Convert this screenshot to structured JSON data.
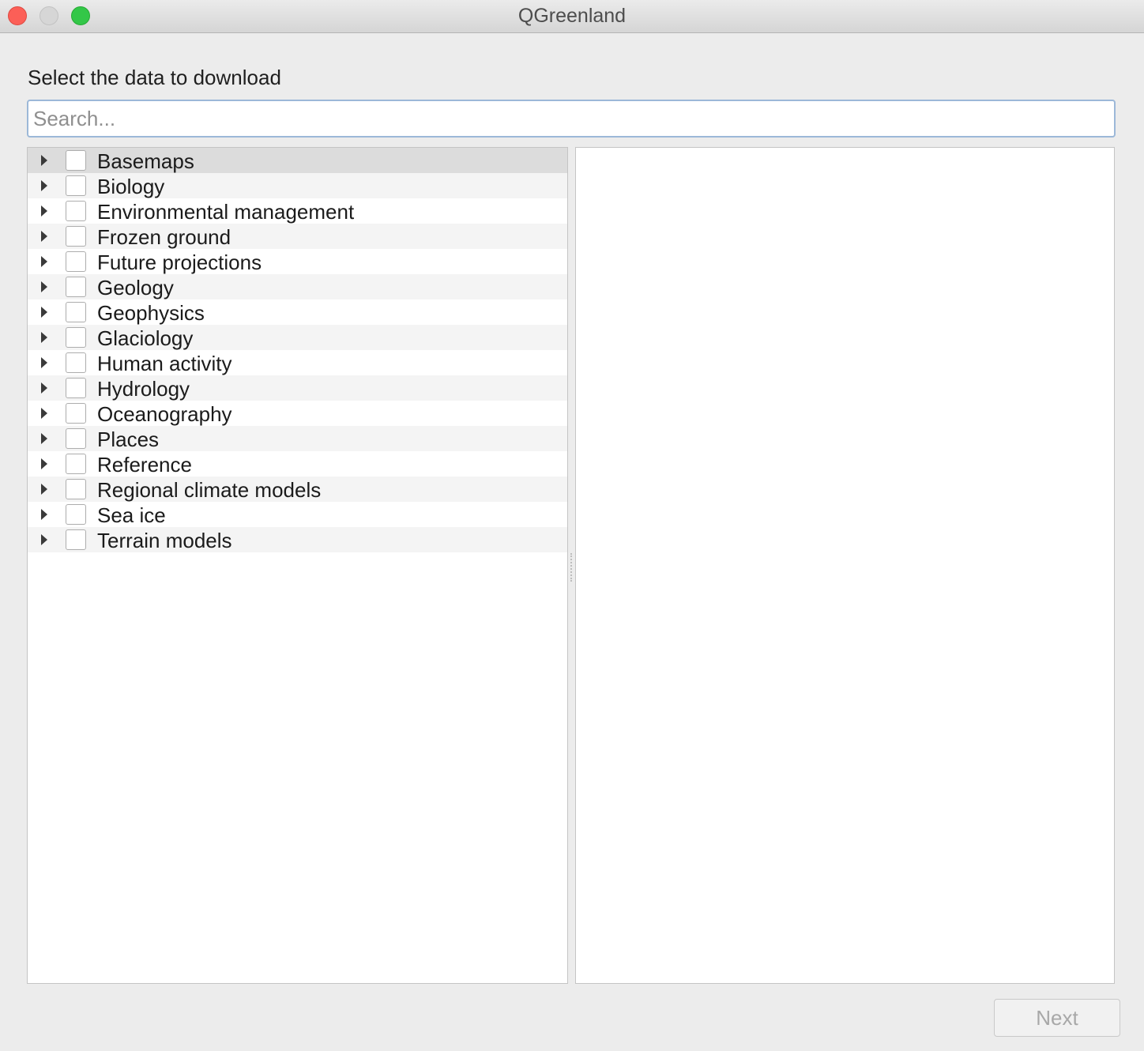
{
  "window": {
    "title": "QGreenland"
  },
  "heading": "Select the data to download",
  "search": {
    "placeholder": "Search...",
    "value": ""
  },
  "tree": {
    "items": [
      {
        "label": "Basemaps",
        "checked": false,
        "expanded": false
      },
      {
        "label": "Biology",
        "checked": false,
        "expanded": false
      },
      {
        "label": "Environmental management",
        "checked": false,
        "expanded": false
      },
      {
        "label": "Frozen ground",
        "checked": false,
        "expanded": false
      },
      {
        "label": "Future projections",
        "checked": false,
        "expanded": false
      },
      {
        "label": "Geology",
        "checked": false,
        "expanded": false
      },
      {
        "label": "Geophysics",
        "checked": false,
        "expanded": false
      },
      {
        "label": "Glaciology",
        "checked": false,
        "expanded": false
      },
      {
        "label": "Human activity",
        "checked": false,
        "expanded": false
      },
      {
        "label": "Hydrology",
        "checked": false,
        "expanded": false
      },
      {
        "label": "Oceanography",
        "checked": false,
        "expanded": false
      },
      {
        "label": "Places",
        "checked": false,
        "expanded": false
      },
      {
        "label": "Reference",
        "checked": false,
        "expanded": false
      },
      {
        "label": "Regional climate models",
        "checked": false,
        "expanded": false
      },
      {
        "label": "Sea ice",
        "checked": false,
        "expanded": false
      },
      {
        "label": "Terrain models",
        "checked": false,
        "expanded": false
      }
    ]
  },
  "footer": {
    "next_label": "Next",
    "next_enabled": false
  }
}
